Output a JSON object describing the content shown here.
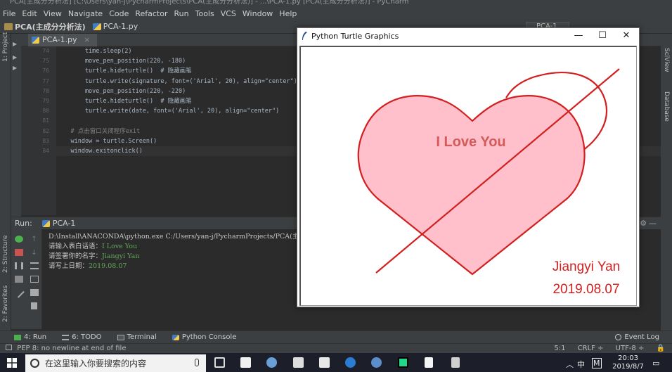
{
  "ide": {
    "title": "PCA[主成分分析法] [C:\\Users\\yan-j\\PycharmProjects\\PCA(主成分分析法)] - ...\\PCA-1.py [PCA(主成分分析法)] - PyCharm",
    "menu": [
      "File",
      "Edit",
      "View",
      "Navigate",
      "Code",
      "Refactor",
      "Run",
      "Tools",
      "VCS",
      "Window",
      "Help"
    ],
    "breadcrumb": {
      "project": "PCA(主成分分析法)",
      "file": "PCA-1.py"
    },
    "run_config": "PCA-1",
    "editor_tab": "PCA-1.py",
    "side_tabs_left": [
      "1: Project",
      "2: Structure",
      "2: Favorites"
    ],
    "side_tabs_right": [
      "SciView",
      "Database"
    ],
    "line_numbers": [
      "74",
      "75",
      "76",
      "77",
      "78",
      "79",
      "80",
      "81",
      "82",
      "83",
      "84"
    ],
    "code_lines": [
      "        time.sleep(2)",
      "        move_pen_position(220, -180)",
      "        turtle.hideturtle()  # 隐藏画笔",
      "        turtle.write(signature, font=('Arial', 20), align=\"center\")",
      "        move_pen_position(220, -220)",
      "        turtle.hideturtle()  # 隐藏画笔",
      "        turtle.write(date, font=('Arial', 20), align=\"center\")",
      "",
      "    # 点击窗口关闭程序exit",
      "    window = turtle.Screen()",
      "    window.exitonclick()"
    ],
    "run_panel": {
      "label": "Run:",
      "tab": "PCA-1",
      "console": [
        {
          "prompt": "D:\\Install\\ANACONDA\\python.exe C:/Users/yan-j/PycharmProjects/PCA(主成分分析法",
          "input": ""
        },
        {
          "prompt": "请输入表白话语：",
          "input": "I Love You"
        },
        {
          "prompt": "请签署你的名字：",
          "input": "Jiangyi Yan"
        },
        {
          "prompt": "请写上日期：",
          "input": "2019.08.07"
        }
      ]
    },
    "bottom_tabs": [
      "4: Run",
      "6: TODO",
      "Terminal",
      "Python Console"
    ],
    "event_log": "Event Log",
    "status": {
      "message": "PEP 8: no newline at end of file",
      "position": "5:1",
      "line_sep": "CRLF ÷",
      "encoding": "UTF-8 ÷"
    }
  },
  "turtle_window": {
    "title": "Python Turtle Graphics",
    "message": "I Love You",
    "signature": "Jiangyi Yan",
    "date": "2019.08.07",
    "colors": {
      "stroke": "#d21f1f",
      "fill": "#ffc0cb",
      "text": "#d25a5a"
    }
  },
  "taskbar": {
    "search_placeholder": "在这里输入你要搜索的内容",
    "time": "20:03",
    "date": "2019/8/7",
    "ime": "中",
    "ime_mode": "M"
  }
}
